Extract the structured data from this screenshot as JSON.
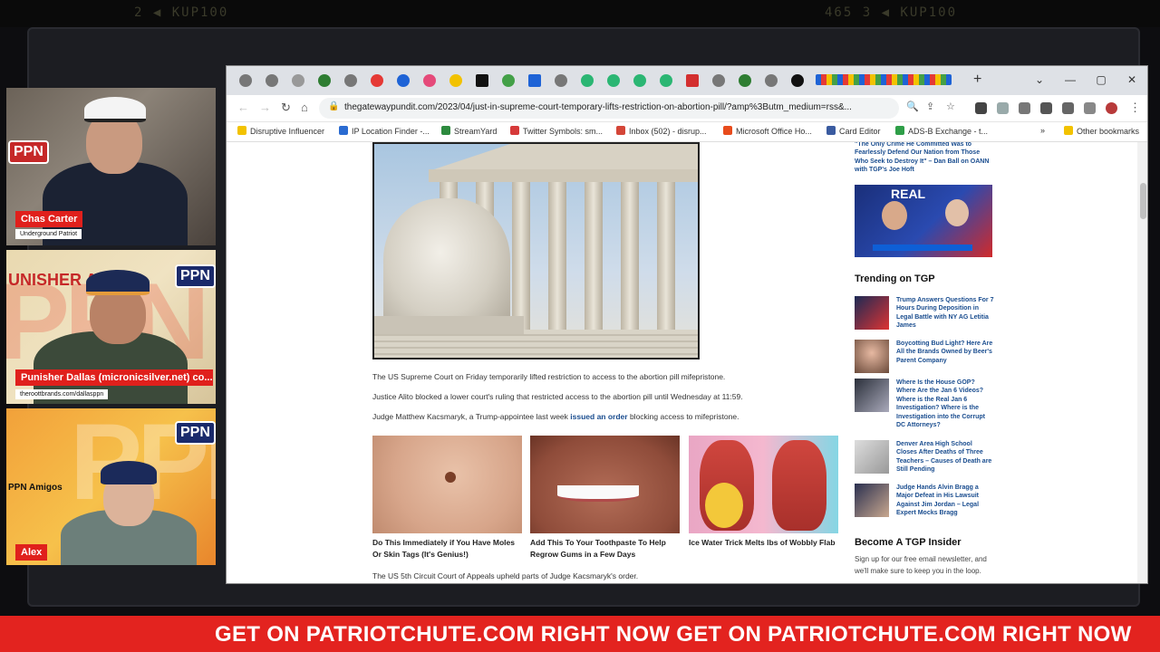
{
  "studio": {
    "digits_left": "2  ◀   KUP100",
    "digits_right": "465   3  ◀   KUP100"
  },
  "cams": [
    {
      "name": "Chas Carter",
      "subtitle": "Underground Patriot"
    },
    {
      "name": "Punisher Dallas (micronicsilver.net) co...",
      "subtitle": "theroottbrands.com/dallasppn",
      "watermark": "UNISHER ALLAS"
    },
    {
      "name": "Alex",
      "subtitle": "PPN Amigos"
    }
  ],
  "browser": {
    "url": "thegatewaypundit.com/2023/04/just-in-supreme-court-temporary-lifts-restriction-on-abortion-pill/?amp%3Butm_medium=rss&...",
    "new_tab": "+",
    "window_controls": [
      "⌄",
      "—",
      "▢",
      "✕"
    ],
    "bookmarks": [
      {
        "label": "Disruptive Influencer",
        "color": "#f2c200"
      },
      {
        "label": "IP Location Finder -...",
        "color": "#2a6bd1"
      },
      {
        "label": "StreamYard",
        "color": "#2d8a3e"
      },
      {
        "label": "Twitter Symbols: sm...",
        "color": "#d63a3a"
      },
      {
        "label": "Inbox (502) - disrup...",
        "color": "#d44638"
      },
      {
        "label": "Microsoft Office Ho...",
        "color": "#e84b1c"
      },
      {
        "label": "Card Editor",
        "color": "#3a5ba0"
      },
      {
        "label": "ADS-B Exchange - t...",
        "color": "#2e9e48"
      },
      {
        "label": "»",
        "color": ""
      },
      {
        "label": "Other bookmarks",
        "color": "#f2c200"
      }
    ]
  },
  "article": {
    "p1": "The US Supreme Court on Friday temporarily lifted restriction to access to the abortion pill mifepristone.",
    "p2": "Justice Alito blocked a lower court's ruling that restricted access to the abortion pill until Wednesday at 11:59.",
    "p3_before": "Judge Matthew Kacsmaryk, a Trump-appointee last week ",
    "p3_link": "issued an order",
    "p3_after": " blocking access to mifepristone.",
    "p4": "The US 5th Circuit Court of Appeals upheld parts of Judge Kacsmaryk's order.",
    "ads": [
      {
        "caption": "Do This Immediately if You Have Moles Or Skin Tags (It's Genius!)"
      },
      {
        "caption": "Add This To Your Toothpaste To Help Regrow Gums in a Few Days"
      },
      {
        "caption": "Ice Water Trick Melts lbs of Wobbly Flab"
      }
    ]
  },
  "sidebar": {
    "top_link": "\"The Only Crime He Committed Was to Fearlessly Defend Our Nation from Those Who Seek to Destroy It\" – Dan Ball on OANN with TGP's Joe Hoft",
    "video_label": "REAL",
    "trending_title": "Trending on TGP",
    "trending": [
      {
        "text": "Trump Answers Questions For 7 Hours During Deposition in Legal Battle with NY AG Letitia James"
      },
      {
        "text": "Boycotting Bud Light? Here Are All the Brands Owned by Beer's Parent Company"
      },
      {
        "text": "Where Is the House GOP? Where Are the Jan 6 Videos? Where is the Real Jan 6 Investigation? Where is the Investigation into the Corrupt DC Attorneys?"
      },
      {
        "text": "Denver Area High School Closes After Deaths of Three Teachers – Causes of Death are Still Pending"
      },
      {
        "text": "Judge Hands Alvin Bragg a Major Defeat in His Lawsuit Against Jim Jordan – Legal Expert Mocks Bragg"
      }
    ],
    "insider_title": "Become A TGP Insider",
    "insider_text": "Sign up for our free email newsletter, and we'll make sure to keep you in the loop."
  },
  "ticker": {
    "text": "GET ON PATRIOTCHUTE.COM RIGHT NOW GET ON PATRIOTCHUTE.COM RIGHT NOW"
  }
}
